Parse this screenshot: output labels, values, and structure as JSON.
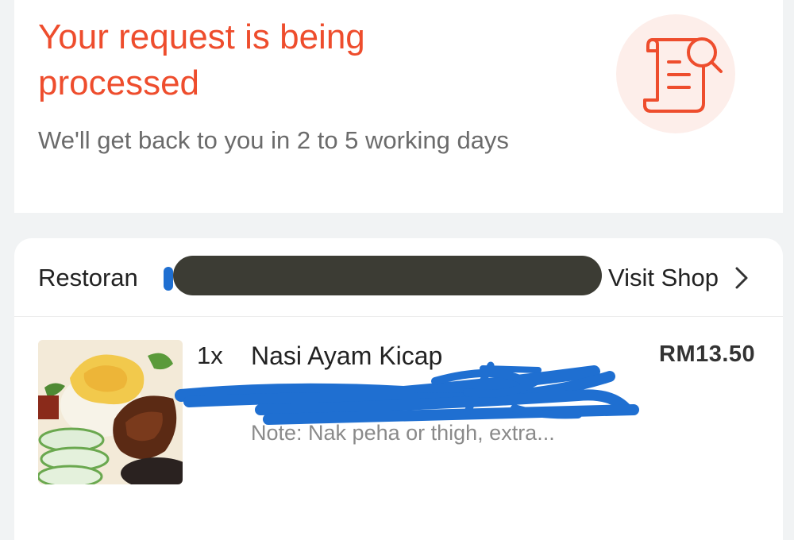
{
  "status": {
    "title": "Your request is being processed",
    "subtitle": "We'll get back to you in 2 to 5 working days",
    "icon": "document-search-icon"
  },
  "shop": {
    "prefix": "Restoran",
    "visit_label": "Visit Shop",
    "chevron_icon": "chevron-right-icon"
  },
  "item": {
    "quantity": "1x",
    "name": "Nasi Ayam Kicap",
    "price": "RM13.50",
    "note": "Note: Nak peha or thigh, extra..."
  },
  "colors": {
    "accent": "#ee4d2d",
    "accent_bg": "#fdeeea",
    "redaction": "#3c3c34",
    "scribble": "#1f6fd1"
  }
}
